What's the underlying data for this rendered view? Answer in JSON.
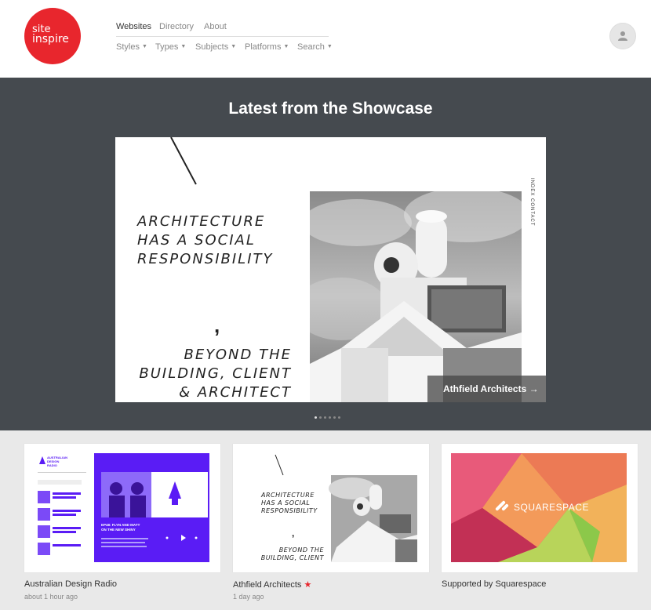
{
  "logo": {
    "line1": "site",
    "line2": "inspire"
  },
  "nav_top": [
    "Websites",
    "Directory",
    "About"
  ],
  "nav_sub": [
    "Styles",
    "Types",
    "Subjects",
    "Platforms",
    "Search"
  ],
  "showcase": {
    "title": "Latest from the Showcase",
    "hero_text_1": "ARCHITECTURE HAS A SOCIAL RESPONSIBILITY",
    "hero_comma": ",",
    "hero_text_2": "BEYOND THE BUILDING, CLIENT & ARCHITECT",
    "vertical_links": "INDEX    CONTACT",
    "caption": "Athfield Architects →",
    "slide_count": 6,
    "active_slide": 1
  },
  "cards": [
    {
      "title": "Australian Design Radio",
      "time": "about 1 hour ago",
      "starred": false,
      "thumb": {
        "brand": "AUSTRALIAN DESIGN RADIO",
        "episode": "EP48: FLYN AND MATT ON THE NEW SHINY"
      }
    },
    {
      "title": "Athfield Architects",
      "time": "1 day ago",
      "starred": true,
      "star": "★",
      "thumb": {
        "text_1": "ARCHITECTURE HAS A SOCIAL RESPONSIBILITY",
        "comma": ",",
        "text_2": "BEYOND THE BUILDING, CLIENT & ARCHITECT"
      }
    },
    {
      "title": "Supported by Squarespace",
      "time": "",
      "starred": false,
      "thumb": {
        "brand": "SQUARESPACE"
      }
    }
  ],
  "colors": {
    "brand_red": "#e8262d",
    "showcase_bg": "#454a4f",
    "page_bg": "#e9e9e9",
    "adr_purple": "#5a1cf5"
  }
}
